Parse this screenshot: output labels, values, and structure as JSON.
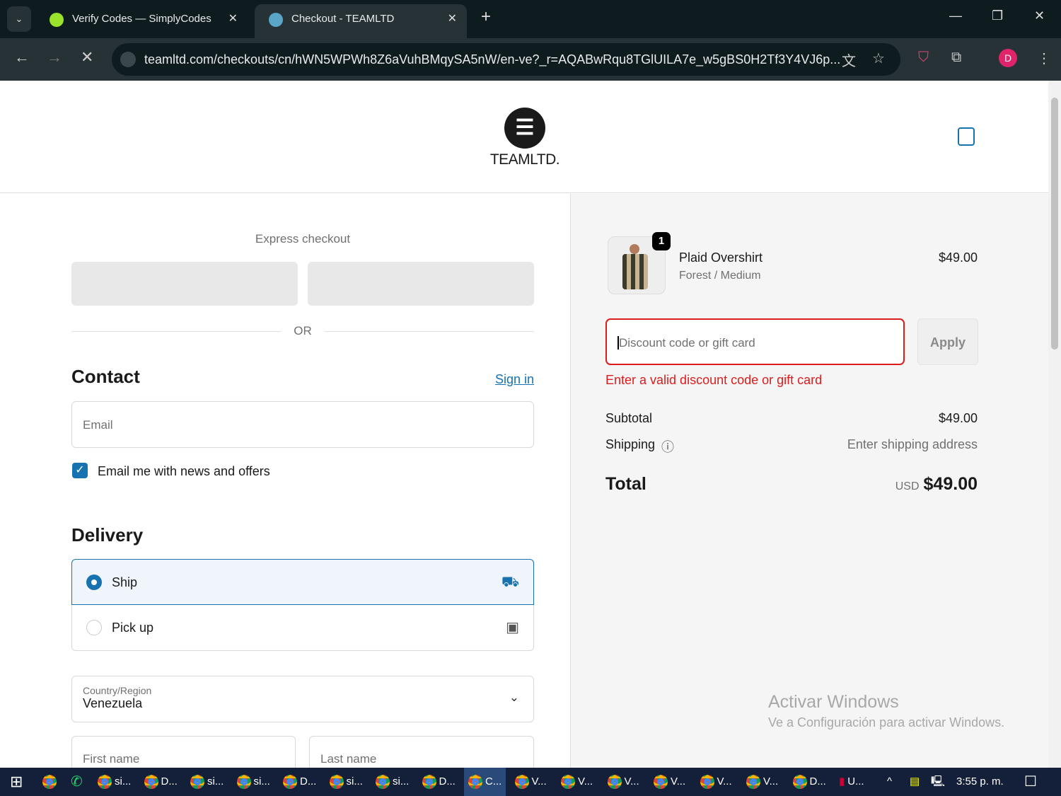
{
  "browser": {
    "tabs": [
      {
        "title": "Verify Codes — SimplyCodes"
      },
      {
        "title": "Checkout - TEAMLTD"
      }
    ],
    "url": "teamltd.com/checkouts/cn/hWN5WPWh8Z6aVuhBMqySA5nW/en-ve?_r=AQABwRqu8TGlUILA7e_w5gBS0H2Tf3Y4VJ6p...",
    "profile": "D"
  },
  "header": {
    "logo_text": "TEAMLTD."
  },
  "checkout": {
    "express_label": "Express checkout",
    "or_label": "OR",
    "contact": {
      "title": "Contact",
      "sign_in": "Sign in",
      "email_placeholder": "Email",
      "newsletter": "Email me with news and offers"
    },
    "delivery": {
      "title": "Delivery",
      "ship": "Ship",
      "pickup": "Pick up",
      "country_label": "Country/Region",
      "country_value": "Venezuela",
      "first_name": "First name",
      "last_name": "Last name"
    }
  },
  "summary": {
    "item": {
      "name": "Plaid Overshirt",
      "variant": "Forest / Medium",
      "price": "$49.00",
      "quantity": "1"
    },
    "discount_placeholder": "Discount code or gift card",
    "apply": "Apply",
    "error": "Enter a valid discount code or gift card",
    "subtotal_label": "Subtotal",
    "subtotal": "$49.00",
    "shipping_label": "Shipping",
    "shipping_value": "Enter shipping address",
    "total_label": "Total",
    "currency": "USD",
    "total": "$49.00"
  },
  "watermark": {
    "title": "Activar Windows",
    "subtitle": "Ve a Configuración para activar Windows."
  },
  "taskbar": {
    "items": [
      "si...",
      "D...",
      "si...",
      "si...",
      "D...",
      "si...",
      "si...",
      "D...",
      "C...",
      "V...",
      "V...",
      "V...",
      "V...",
      "V...",
      "V...",
      "D...",
      "U..."
    ],
    "clock": "3:55 p. m."
  },
  "colors": {
    "accent": "#1773b0",
    "error": "#dd1d1d"
  }
}
